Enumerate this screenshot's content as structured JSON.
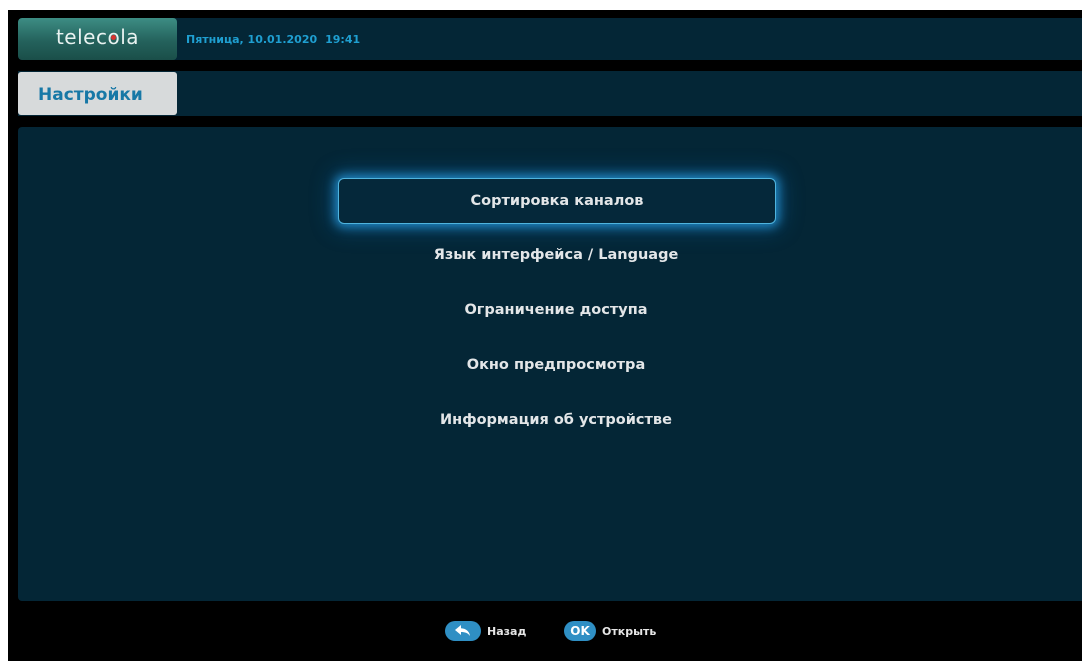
{
  "header": {
    "logo_before": "telec",
    "logo_o": "o",
    "logo_after": "la",
    "date": "Пятница, 10.01.2020",
    "time": "19:41"
  },
  "title": "Настройки",
  "menu": {
    "items": [
      {
        "label": "Сортировка каналов",
        "selected": true
      },
      {
        "label": "Язык интерфейса / Language",
        "selected": false
      },
      {
        "label": "Ограничение доступа",
        "selected": false
      },
      {
        "label": "Окно предпросмотра",
        "selected": false
      },
      {
        "label": "Информация об устройстве",
        "selected": false
      }
    ]
  },
  "footer": {
    "back_icon": "back-arrow-icon",
    "back_label": "Назад",
    "ok_badge": "OK",
    "ok_label": "Открыть"
  },
  "colors": {
    "panel": "#042636",
    "accent": "#1f9fd1",
    "selection_glow": "#28a0e6",
    "logo": "#2e7a72",
    "key_badge": "#2f8fc4"
  }
}
